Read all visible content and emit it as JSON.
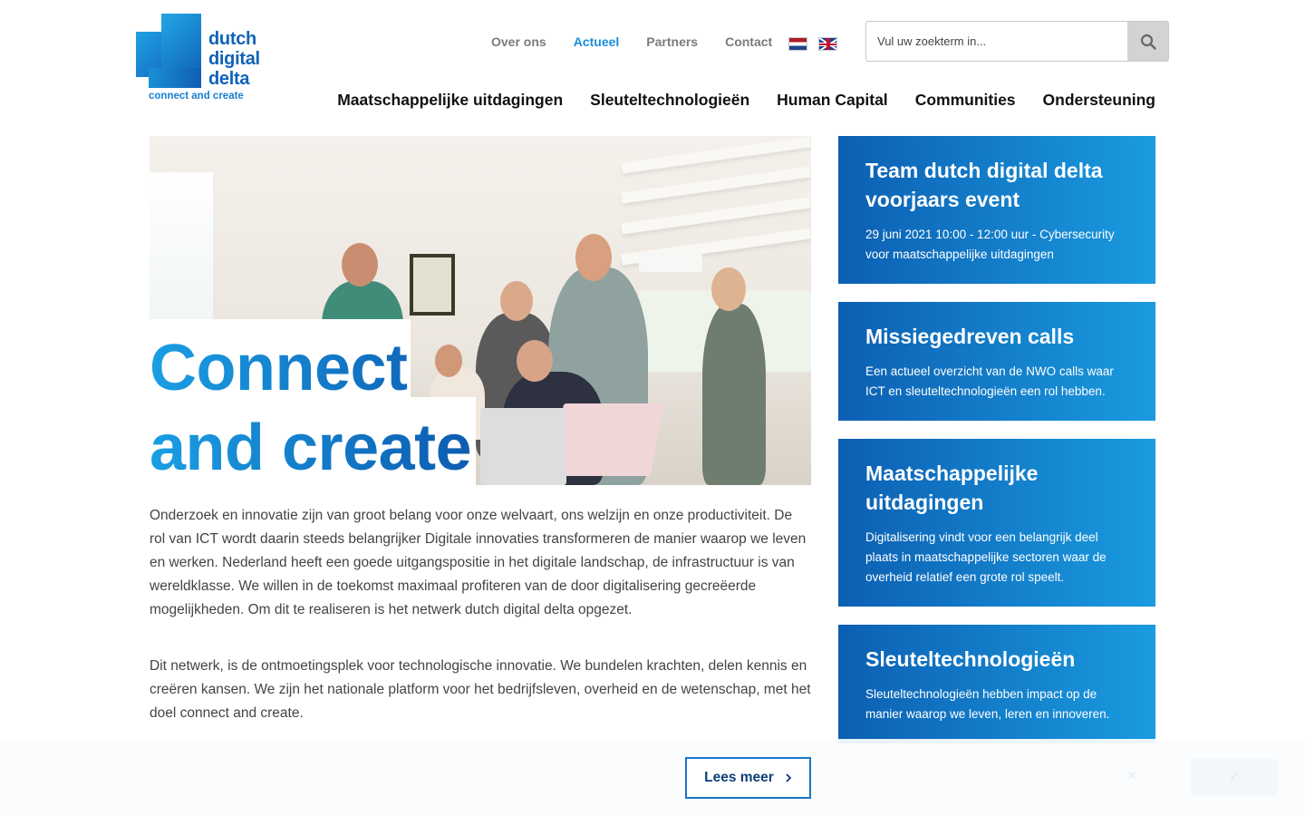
{
  "logo": {
    "lines": [
      "dutch",
      "digital",
      "delta"
    ],
    "tagline": "connect and create"
  },
  "topnav": [
    {
      "label": "Over ons",
      "active": false
    },
    {
      "label": "Actueel",
      "active": true
    },
    {
      "label": "Partners",
      "active": false
    },
    {
      "label": "Contact",
      "active": false
    }
  ],
  "languages": [
    "nl-flag-icon",
    "uk-flag-icon"
  ],
  "search": {
    "placeholder": "Vul uw zoekterm in..."
  },
  "mainnav": [
    "Maatschappelijke uitdagingen",
    "Sleuteltechnologieën",
    "Human Capital",
    "Communities",
    "Ondersteuning"
  ],
  "hero": {
    "title_line1": "Connect",
    "title_line2": "and create"
  },
  "intro": {
    "p1": "Onderzoek en innovatie zijn van groot belang voor onze welvaart, ons welzijn en onze productiviteit. De rol van ICT wordt daarin steeds belangrijker Digitale innovaties transformeren de manier waarop we leven en werken. Nederland heeft een goede uitgangspositie in het digitale landschap, de infrastructuur is van wereldklasse. We willen in de toekomst maximaal profiteren van de door digitalisering gecreëerde mogelijkheden. Om dit te realiseren is het netwerk dutch digital delta opgezet.",
    "p2": "Dit netwerk, is de ontmoetingsplek voor technologische innovatie. We bundelen krachten, delen kennis en creëren kansen. We zijn het nationale platform voor het bedrijfsleven, overheid en de wetenschap, met het doel connect and create."
  },
  "cards": [
    {
      "title": "Team dutch digital delta voorjaars event",
      "text": "29 juni 2021 10:00 - 12:00 uur - Cybersecurity voor maatschappelijke uitdagingen"
    },
    {
      "title": "Missiegedreven calls",
      "text": "Een actueel overzicht van de NWO calls waar ICT en sleuteltechnologieën een rol hebben."
    },
    {
      "title": "Maatschappelijke uitdagingen",
      "text": "Digitalisering vindt voor een belangrijk deel plaats in maatschappelijke sectoren waar de overheid relatief een grote rol speelt."
    },
    {
      "title": "Sleuteltechnologieën",
      "text": "Sleuteltechnologieën hebben impact op de manier waarop we leven, leren en innoveren."
    }
  ],
  "lees_meer": "Lees meer",
  "colors": {
    "accent": "#1a8ed8",
    "gradient_start": "#0c5fb2",
    "gradient_end": "#1a9be0"
  }
}
